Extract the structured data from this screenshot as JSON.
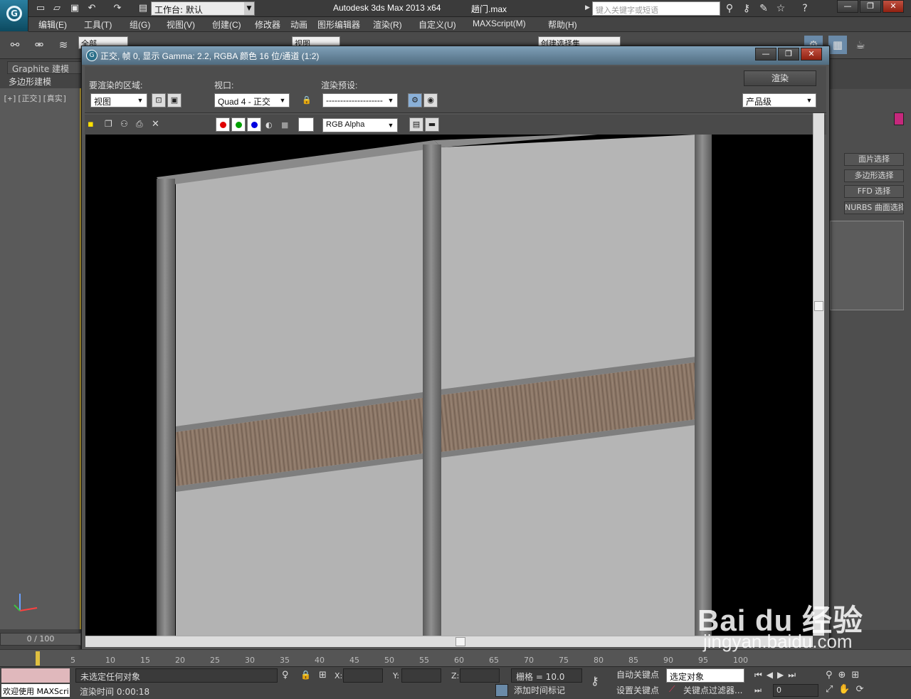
{
  "app": {
    "title": "Autodesk 3ds Max  2013 x64",
    "file": "趟门.max",
    "workspace": "工作台: 默认",
    "search_placeholder": "键入关键字或短语"
  },
  "menus": [
    "编辑(E)",
    "工具(T)",
    "组(G)",
    "视图(V)",
    "创建(C)",
    "修改器",
    "动画",
    "图形编辑器",
    "渲染(R)",
    "自定义(U)",
    "MAXScript(M)",
    "帮助(H)"
  ],
  "toolbar": {
    "selection_filter": "全部",
    "ref_coord": "视图",
    "named_sel": "创建选择集"
  },
  "ribbon": {
    "graphite": "Graphite 建模",
    "poly_modeling": "多边形建模"
  },
  "viewport": {
    "label": "[+][正交][真实]"
  },
  "render_window": {
    "title": "正交, 帧 0, 显示 Gamma: 2.2, RGBA 颜色 16 位/通道 (1:2)",
    "area_label": "要渲染的区域:",
    "area_value": "视图",
    "viewport_label": "视口:",
    "viewport_value": "Quad 4 - 正交",
    "preset_label": "渲染预设:",
    "preset_value": "--------------------",
    "render_button": "渲染",
    "quality": "产品级",
    "channel": "RGB Alpha"
  },
  "command_panel": {
    "buttons": [
      "面片选择",
      "多边形选择",
      "FFD 选择",
      "NURBS 曲面选择"
    ]
  },
  "timeline": {
    "frame": "0 / 100",
    "ticks": [
      "5",
      "10",
      "15",
      "20",
      "25",
      "30",
      "35",
      "40",
      "45",
      "50",
      "55",
      "60",
      "65",
      "70",
      "75",
      "80",
      "85",
      "90",
      "95",
      "100"
    ]
  },
  "status": {
    "welcome": "欢迎使用 MAXScri",
    "selection": "未选定任何对象",
    "render_time": "渲染时间  0:00:18",
    "x_label": "X:",
    "y_label": "Y:",
    "z_label": "Z:",
    "grid": "栅格 = 10.0",
    "add_time_tag": "添加时间标记",
    "auto_key": "自动关键点",
    "set_key": "设置关键点",
    "key_mode": "选定对象",
    "key_filters": "关键点过滤器...",
    "frame_field": "0"
  },
  "watermark": {
    "logo": "Bai du 经验",
    "url": "jingyan.baidu.com"
  },
  "colors": {
    "accent": "#c6287c",
    "titlebar": "#506c80",
    "wood": "#8a7565",
    "panel": "#b3b3b3"
  }
}
